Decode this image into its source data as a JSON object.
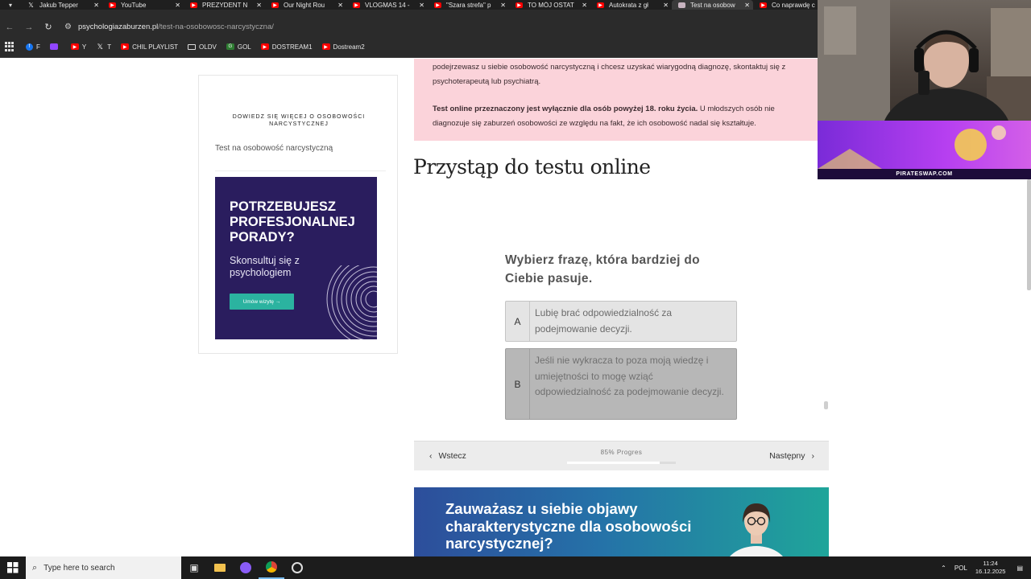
{
  "browser": {
    "tabs": [
      {
        "title": "Jakub Tepper",
        "icon": "x-icon"
      },
      {
        "title": "YouTube",
        "icon": "youtube-icon"
      },
      {
        "title": "PREZYDENT N",
        "icon": "youtube-icon"
      },
      {
        "title": "Our Night Rou",
        "icon": "youtube-icon"
      },
      {
        "title": "VLOGMAS 14 -",
        "icon": "youtube-icon"
      },
      {
        "title": "\"Szara strefa\" p",
        "icon": "youtube-icon"
      },
      {
        "title": "TO MÓJ OSTAT",
        "icon": "youtube-icon"
      },
      {
        "title": "Autokrata z gł",
        "icon": "youtube-icon"
      },
      {
        "title": "Test na osobow",
        "icon": "site-icon",
        "active": true
      },
      {
        "title": "Co naprawdę c",
        "icon": "youtube-icon"
      }
    ],
    "url": {
      "domain": "psychologiazaburzen.pl",
      "path": "/test-na-osobowosc-narcystyczna/"
    },
    "bookmarks": [
      {
        "label": "F",
        "icon": "facebook-icon"
      },
      {
        "label": "",
        "icon": "twitch-icon"
      },
      {
        "label": "Y",
        "icon": "youtube-icon"
      },
      {
        "label": "T",
        "icon": "x-icon"
      },
      {
        "label": "CHIL PLAYLIST",
        "icon": "youtube-icon"
      },
      {
        "label": "OLDV",
        "icon": "folder-icon"
      },
      {
        "label": "GOL",
        "icon": "gol-icon"
      },
      {
        "label": "DOSTREAM1",
        "icon": "youtube-icon"
      },
      {
        "label": "Dostream2",
        "icon": "youtube-icon"
      }
    ]
  },
  "sidebar": {
    "heading": "DOWIEDZ SIĘ WIĘCEJ O OSOBOWOŚCI NARCYSTYCZNEJ",
    "link": "Test na osobowość narcystyczną",
    "ad": {
      "title": "POTRZEBUJESZ PROFESJONALNEJ PORADY?",
      "subtitle": "Skonsultuj się z psychologiem",
      "button": "Umów wizytę →",
      "bg_color": "#2a1d5e",
      "button_color": "#2bb3a0"
    }
  },
  "notice": {
    "para1": "podejrzewasz u siebie osobowość narcystyczną i chcesz uzyskać wiarygodną diagnozę, skontaktuj się z psychoterapeutą lub psychiatrą.",
    "para2_bold": "Test online przeznaczony jest wyłącznie dla osób powyżej 18. roku życia.",
    "para2_rest": " U młodszych osób nie diagnozuje się zaburzeń osobowości ze względu na fakt, że ich osobowość nadal się kształtuje.",
    "bg_color": "#fbd3da"
  },
  "main": {
    "section_title": "Przystąp do testu online",
    "question": "Wybierz frazę, która bardziej do Ciebie pasuje.",
    "answers": [
      {
        "letter": "A",
        "text": "Lubię brać odpowiedzialność za podejmowanie decyzji."
      },
      {
        "letter": "B",
        "text": "Jeśli nie wykracza to poza moją wiedzę i umiejętności to mogę wziąć odpowiedzialność za podejmowanie decyzji."
      }
    ],
    "nav": {
      "back": "Wstecz",
      "next": "Następny",
      "progress_label": "85% Progres",
      "progress_value": 0.85
    },
    "banner": {
      "text": "Zauważasz u siebie objawy charakterystyczne dla osobowości narcystycznej?"
    }
  },
  "stream_overlay": {
    "sponsor": "PIRATESWAP.COM"
  },
  "taskbar": {
    "search_placeholder": "Type here to search",
    "language": "POL",
    "time": "11:24",
    "date": "16.12.2025"
  }
}
